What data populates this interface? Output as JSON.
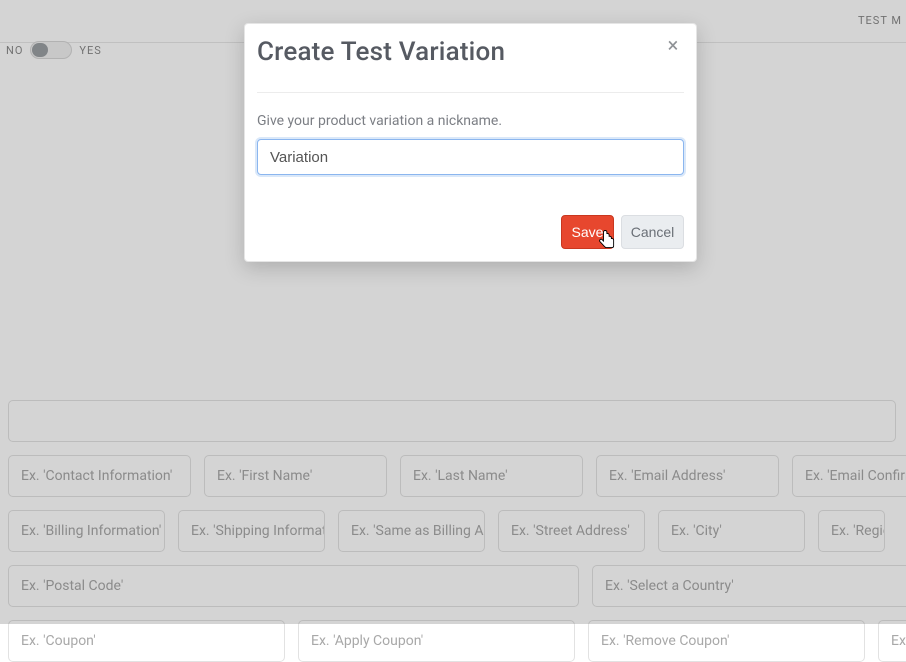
{
  "header": {
    "testLink": "TEST M"
  },
  "toggle": {
    "noLabel": "NO",
    "yesLabel": "YES"
  },
  "modal": {
    "title": "Create Test Variation",
    "instruction": "Give your product variation a nickname.",
    "inputValue": "Variation",
    "saveLabel": "Save",
    "cancelLabel": "Cancel"
  },
  "bgFields": {
    "row1": [
      ""
    ],
    "row2": [
      "Ex. 'Contact Information'",
      "Ex. 'First Name'",
      "Ex. 'Last Name'",
      "Ex. 'Email Address'",
      "Ex. 'Email Confirm"
    ],
    "row3": [
      "Ex. 'Billing Information'",
      "Ex. 'Shipping Informati",
      "Ex. 'Same as Billing Ad",
      "Ex. 'Street Address'",
      "Ex. 'City'",
      "Ex. 'Regio"
    ],
    "row4a": "Ex. 'Postal Code'",
    "row4b": "Ex. 'Select a Country'",
    "row5": [
      "Ex. 'Coupon'",
      "Ex. 'Apply Coupon'",
      "Ex. 'Remove Coupon'",
      "Ex"
    ]
  }
}
